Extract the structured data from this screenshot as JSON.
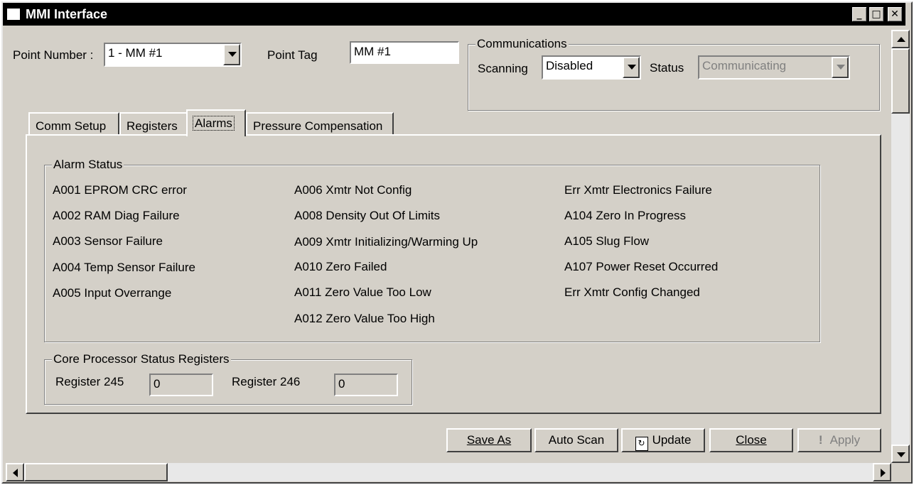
{
  "window": {
    "title": "MMI Interface"
  },
  "header": {
    "point_number_label": "Point Number :",
    "point_number_value": "1 - MM #1",
    "point_tag_label": "Point Tag",
    "point_tag_value": "MM #1"
  },
  "communications": {
    "legend": "Communications",
    "scanning_label": "Scanning",
    "scanning_value": "Disabled",
    "status_label": "Status",
    "status_value": "Communicating"
  },
  "tabs": [
    {
      "label": "Comm Setup",
      "active": false
    },
    {
      "label": "Registers",
      "active": false
    },
    {
      "label": "Alarms",
      "active": true
    },
    {
      "label": "Pressure Compensation",
      "active": false
    }
  ],
  "alarm_status": {
    "legend": "Alarm Status",
    "col1": [
      "A001  EPROM CRC error",
      "A002  RAM Diag Failure",
      "A003  Sensor Failure",
      "A004  Temp Sensor Failure",
      "A005  Input Overrange"
    ],
    "col2": [
      "A006 Xmtr Not Config",
      "A008  Density Out Of Limits",
      "A009  Xmtr Initializing/Warming Up",
      "A010  Zero Failed",
      "A011  Zero Value Too Low",
      "A012  Zero Value Too High"
    ],
    "col3": [
      "Err  Xmtr Electronics Failure",
      "A104  Zero In Progress",
      "A105  Slug Flow",
      "A107  Power Reset Occurred",
      "Err  Xmtr Config Changed"
    ]
  },
  "core_processor": {
    "legend": "Core Processor Status Registers",
    "reg245_label": "Register 245",
    "reg245_value": "0",
    "reg246_label": "Register 246",
    "reg246_value": "0"
  },
  "buttons": {
    "save_as": "Save As",
    "auto_scan": "Auto Scan",
    "update": "Update",
    "close": "Close",
    "apply": "Apply"
  }
}
